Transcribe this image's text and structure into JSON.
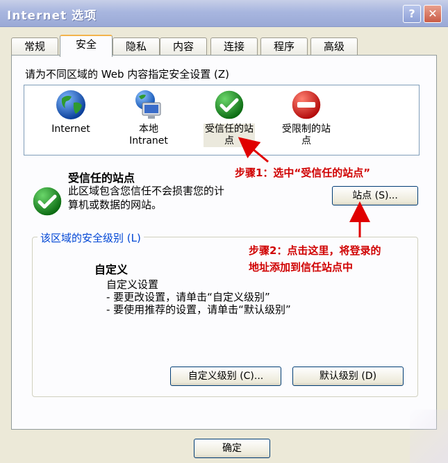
{
  "window": {
    "title": "Internet 选项",
    "help_glyph": "?",
    "close_glyph": "✕"
  },
  "tabs": [
    {
      "label": "常规"
    },
    {
      "label": "安全",
      "active": true
    },
    {
      "label": "隐私"
    },
    {
      "label": "内容"
    },
    {
      "label": "连接"
    },
    {
      "label": "程序"
    },
    {
      "label": "高级"
    }
  ],
  "security": {
    "instruction": "请为不同区域的 Web 内容指定安全设置 (Z)",
    "zones": [
      {
        "name_line1": "Internet",
        "name_line2": "",
        "icon": "globe-icon"
      },
      {
        "name_line1": "本地",
        "name_line2": "Intranet",
        "icon": "local-intranet-icon"
      },
      {
        "name_line1": "受信任的站",
        "name_line2": "点",
        "icon": "check-icon",
        "selected": true
      },
      {
        "name_line1": "受限制的站",
        "name_line2": "点",
        "icon": "no-entry-icon"
      }
    ],
    "selected_zone_title": "受信任的站点",
    "selected_zone_desc_line1": "此区域包含您信任不会损害您的计",
    "selected_zone_desc_line2": "算机或数据的网站。",
    "sites_button": "站点 (S)...",
    "level_group_label": "该区域的安全级别 (L)",
    "level_title": "自定义",
    "level_line1": "自定义设置",
    "level_line2": "- 要更改设置，请单击“自定义级别”",
    "level_line3": "- 要使用推荐的设置，请单击“默认级别”",
    "custom_level_button": "自定义级别 (C)...",
    "default_level_button": "默认级别 (D)"
  },
  "footer": {
    "ok_button": "确定"
  },
  "annotations": {
    "step1": "步骤1：选中“受信任的站点”",
    "step2_line1": "步骤2：点击这里，将登录的",
    "step2_line2": "地址添加到信任站点中",
    "color": "#d00000"
  }
}
